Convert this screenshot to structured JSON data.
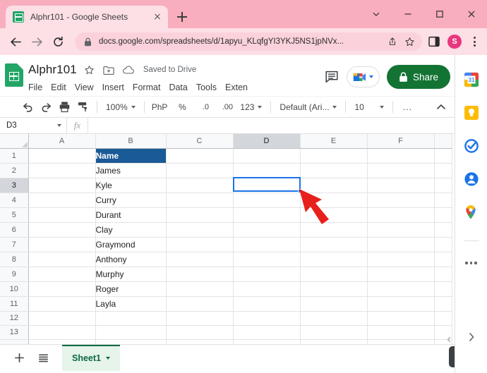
{
  "browser": {
    "tab": {
      "title": "Alphr101 - Google Sheets",
      "favicon": "sheets-favicon",
      "close_label": "x"
    },
    "new_tab_label": "+",
    "window_controls": [
      "tab-search-chevron",
      "minimize",
      "maximize",
      "close"
    ],
    "nav": {
      "back": "back-arrow",
      "forward": "forward-arrow",
      "reload": "reload-arrow"
    },
    "omnibox": {
      "lock": "lock-icon",
      "url": "docs.google.com/spreadsheets/d/1apyu_KLqfgYI3YKJ5NS1jpNVx...",
      "share_icon": "share-icon",
      "bookmark_icon": "star-icon",
      "sidepanel_icon": "side-panel-icon",
      "profile_initial": "S",
      "menu_icon": "kebab-menu-icon"
    }
  },
  "sheets": {
    "doc_title": "Alphr101",
    "star_icon": "star-icon",
    "move_icon": "move-to-folder-icon",
    "cloud_icon": "cloud-icon",
    "save_status": "Saved to Drive",
    "menu": [
      "File",
      "Edit",
      "View",
      "Insert",
      "Format",
      "Data",
      "Tools",
      "Exten"
    ],
    "comment_icon": "comment-icon",
    "meet_icon": "google-meet-icon",
    "share_button": {
      "label": "Share",
      "icon": "lock-icon",
      "color": "#137333"
    },
    "account_initial": "S",
    "toolbar": {
      "undo": "undo-icon",
      "redo": "redo-icon",
      "print": "print-icon",
      "paint_format": "paint-format-icon",
      "zoom": "100%",
      "currency": "PhP",
      "percent": "%",
      "decrease_decimal": ".0",
      "increase_decimal": ".00",
      "number_format": "123",
      "font": "Default (Ari...",
      "font_size": "10",
      "more": "...",
      "collapse": "collapse-chevron"
    },
    "formula_bar": {
      "name_box": "D3",
      "fx_label": "fx",
      "value": ""
    },
    "grid": {
      "columns": [
        "A",
        "B",
        "C",
        "D",
        "E",
        "F"
      ],
      "selected_column": "D",
      "selected_row": 3,
      "selected_cell": "D3",
      "rows": [
        {
          "n": 1,
          "B": "Name"
        },
        {
          "n": 2,
          "B": "James"
        },
        {
          "n": 3,
          "B": "Kyle"
        },
        {
          "n": 4,
          "B": "Curry"
        },
        {
          "n": 5,
          "B": "Durant"
        },
        {
          "n": 6,
          "B": "Clay"
        },
        {
          "n": 7,
          "B": "Graymond"
        },
        {
          "n": 8,
          "B": "Anthony"
        },
        {
          "n": 9,
          "B": "Murphy"
        },
        {
          "n": 10,
          "B": "Roger"
        },
        {
          "n": 11,
          "B": "Layla"
        },
        {
          "n": 12,
          "B": ""
        },
        {
          "n": 13,
          "B": ""
        }
      ],
      "header_cell_fill": "#1a5a96",
      "selection_color": "#1a73e8",
      "annotation_arrow_color": "#e8201b"
    },
    "bottom": {
      "add_sheet": "add-sheet-icon",
      "all_sheets": "all-sheets-icon",
      "sheet_tab": "Sheet1",
      "sheet_tab_caret": "chevron-down-icon",
      "explore": "explore-icon"
    },
    "side_panel": {
      "items": [
        {
          "name": "google-calendar-icon",
          "day": "31"
        },
        {
          "name": "google-keep-icon"
        },
        {
          "name": "google-tasks-icon"
        },
        {
          "name": "google-contacts-icon"
        },
        {
          "name": "google-maps-icon"
        }
      ],
      "more": "more-icon",
      "expand": "expand-chevron-icon"
    }
  }
}
